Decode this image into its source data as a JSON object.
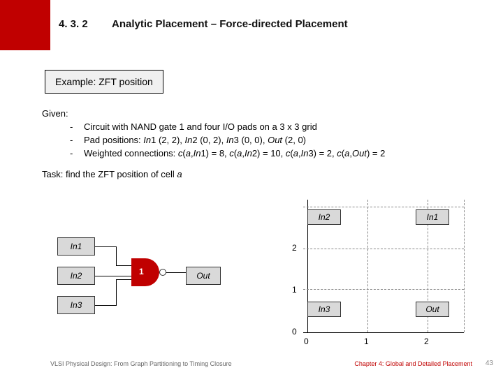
{
  "header": {
    "section": "4. 3. 2",
    "title": "Analytic Placement – Force-directed Placement"
  },
  "example": {
    "label": "Example: ZFT position"
  },
  "given": {
    "lead": "Given:",
    "b1": "Circuit with NAND gate 1 and four I/O pads on a 3 x 3 grid",
    "b2_pre": "Pad positions: ",
    "b2_in1": "In",
    "b2_in1_n": "1 (2, 2),   ",
    "b2_in2": "In",
    "b2_in2_n": "2 (0, 2),   ",
    "b2_in3": "In",
    "b2_in3_n": "3 (0, 0),   ",
    "b2_out": "Out",
    "b2_out_n": " (2, 0)",
    "b3_pre": "Weighted connections: ",
    "b3_c1a": "c",
    "b3_c1b": "(",
    "b3_c1c": "a",
    "b3_c1d": ",",
    "b3_c1e": "In",
    "b3_c1f": "1) = 8,   ",
    "b3_c2a": "c",
    "b3_c2b": "(",
    "b3_c2c": "a",
    "b3_c2d": ",",
    "b3_c2e": "In",
    "b3_c2f": "2) = 10,   ",
    "b3_c3a": "c",
    "b3_c3b": "(",
    "b3_c3c": "a",
    "b3_c3d": ",",
    "b3_c3e": "In",
    "b3_c3f": "3) = 2,   ",
    "b3_c4a": "c",
    "b3_c4b": "(",
    "b3_c4c": "a",
    "b3_c4d": ",",
    "b3_c4e": "Out",
    "b3_c4f": ") = 2"
  },
  "task": {
    "pre": "Task: find the ZFT position of cell ",
    "cell": "a"
  },
  "circuit": {
    "in1": "In1",
    "in2": "In2",
    "in3": "In3",
    "out": "Out",
    "gate": "1"
  },
  "grid": {
    "in1": "In1",
    "in2": "In2",
    "in3": "In3",
    "out": "Out",
    "y2": "2",
    "y1": "1",
    "y0": "0",
    "x0": "0",
    "x1": "1",
    "x2": "2"
  },
  "footer": {
    "left": "VLSI Physical Design: From Graph Partitioning to Timing Closure",
    "right": "Chapter 4: Global and Detailed Placement",
    "page": "43"
  },
  "chart_data": {
    "type": "table",
    "title": "Force-directed placement: ZFT position of cell a",
    "grid": {
      "rows": 3,
      "cols": 3
    },
    "pads": [
      {
        "name": "In1",
        "x": 2,
        "y": 2
      },
      {
        "name": "In2",
        "x": 0,
        "y": 2
      },
      {
        "name": "In3",
        "x": 0,
        "y": 0
      },
      {
        "name": "Out",
        "x": 2,
        "y": 0
      }
    ],
    "weights": [
      {
        "pair": [
          "a",
          "In1"
        ],
        "c": 8
      },
      {
        "pair": [
          "a",
          "In2"
        ],
        "c": 10
      },
      {
        "pair": [
          "a",
          "In3"
        ],
        "c": 2
      },
      {
        "pair": [
          "a",
          "Out"
        ],
        "c": 2
      }
    ]
  }
}
